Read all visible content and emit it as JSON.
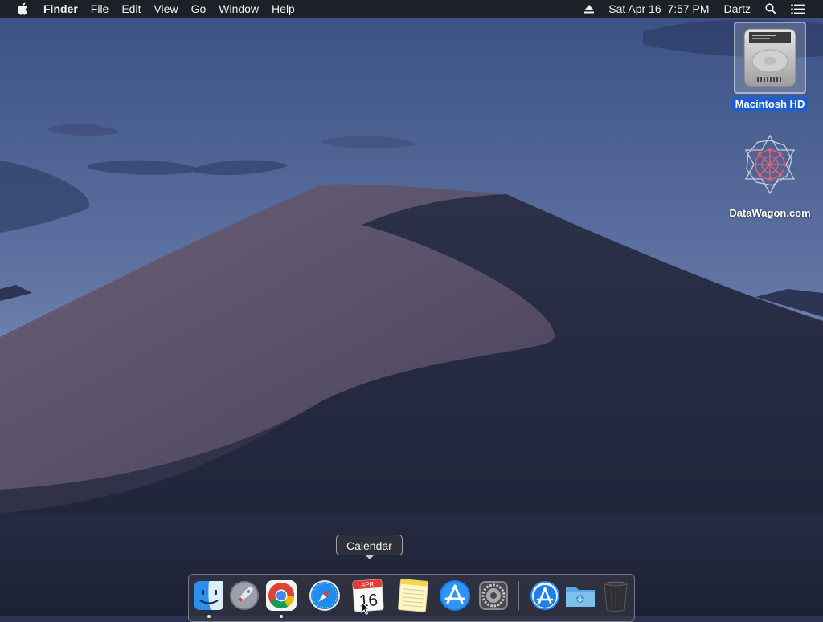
{
  "menubar": {
    "app_name": "Finder",
    "menus": [
      "File",
      "Edit",
      "View",
      "Go",
      "Window",
      "Help"
    ],
    "clock": "Sat Apr 16  7:57 PM",
    "user": "Dartz",
    "icons": [
      "apple-icon",
      "eject-icon",
      "spotlight-search-icon",
      "notification-center-icon"
    ]
  },
  "desktop": {
    "icons": [
      {
        "label": "Macintosh HD",
        "icon": "hard-drive-icon",
        "selected": true
      },
      {
        "label": "DataWagon.com",
        "icon": "datawagon-logo-icon",
        "selected": false
      }
    ]
  },
  "tooltip": {
    "text": "Calendar"
  },
  "dock": {
    "apps": [
      {
        "name": "Finder",
        "icon": "finder-icon",
        "running": true
      },
      {
        "name": "Launchpad",
        "icon": "launchpad-icon",
        "running": false
      },
      {
        "name": "Google Chrome",
        "icon": "chrome-icon",
        "running": true
      },
      {
        "name": "Safari",
        "icon": "safari-icon",
        "running": false
      },
      {
        "name": "Calendar",
        "icon": "calendar-icon",
        "running": false
      },
      {
        "name": "Notes",
        "icon": "notes-icon",
        "running": false
      },
      {
        "name": "App Store",
        "icon": "app-store-icon",
        "running": false
      },
      {
        "name": "System Preferences",
        "icon": "system-preferences-icon",
        "running": false
      },
      {
        "name": "Applications",
        "icon": "applications-folder-icon",
        "running": false
      },
      {
        "name": "Downloads",
        "icon": "downloads-folder-icon",
        "running": false
      },
      {
        "name": "Trash",
        "icon": "trash-icon",
        "running": false
      }
    ],
    "calendar_month": "APR",
    "calendar_day": "16"
  },
  "colors": {
    "selection": "#1b5fd3",
    "sky_top": "#3d5286",
    "sky_bottom": "#7f8fb4",
    "dune_dark": "#262a40"
  }
}
